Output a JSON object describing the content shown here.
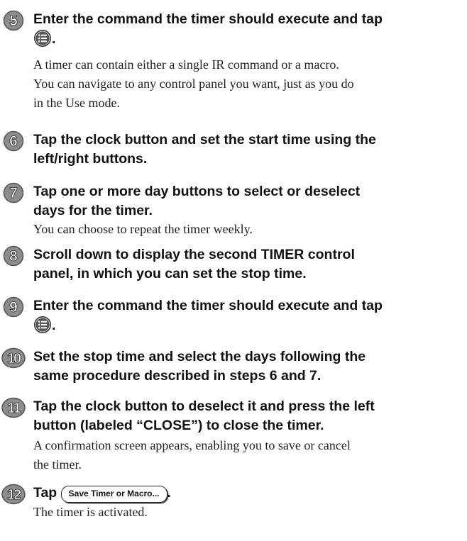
{
  "steps": [
    {
      "num": "5",
      "head_a": "Enter the command the timer should execute and tap",
      "icon": "menu-list-icon",
      "head_b": ".",
      "body": [
        "A timer can contain either a single IR command or a macro.",
        "You can navigate to any control panel you want, just as you do",
        "in the Use mode."
      ]
    },
    {
      "num": "6",
      "head": [
        "Tap the clock button and set the start time using the",
        "left/right buttons."
      ]
    },
    {
      "num": "7",
      "head": [
        "Tap one or more day buttons to select or deselect",
        "days for the timer."
      ],
      "body": [
        "You can choose to repeat the timer weekly."
      ]
    },
    {
      "num": "8",
      "head": [
        "Scroll down to display the second TIMER control",
        "panel, in which you can set the stop time."
      ]
    },
    {
      "num": "9",
      "head_a": "Enter the command the timer should execute and tap",
      "icon": "menu-list-icon",
      "head_b": "."
    },
    {
      "num": "10",
      "head": [
        "Set the stop time and select the days following the",
        "same procedure described in steps 6 and 7."
      ]
    },
    {
      "num": "11",
      "head": [
        "Tap the clock button to deselect it and press the left",
        "button (labeled “CLOSE”) to close the timer."
      ],
      "body": [
        "A confirmation screen appears, enabling you to save or cancel",
        "the timer."
      ]
    },
    {
      "num": "12",
      "head_a": "Tap",
      "button_label": "Save Timer or Macro...",
      "head_b": ".",
      "body": [
        "The timer is activated."
      ]
    }
  ]
}
